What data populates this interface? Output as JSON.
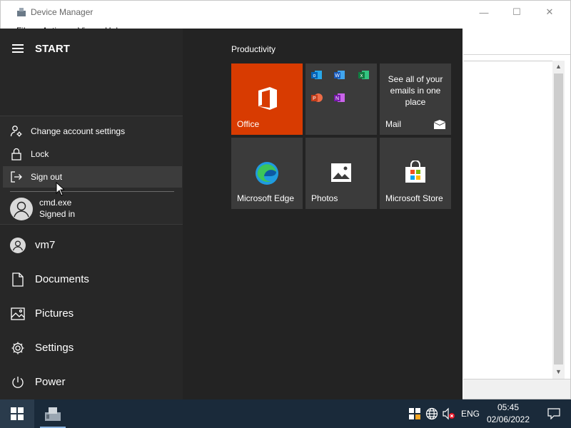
{
  "window": {
    "title": "Device Manager",
    "menu": [
      "File",
      "Action",
      "View",
      "Help"
    ],
    "controls": {
      "minimize": "—",
      "maximize": "☐",
      "close": "✕"
    }
  },
  "start": {
    "label": "START",
    "account_menu": [
      {
        "label": "Change account settings",
        "icon": "person-settings-icon"
      },
      {
        "label": "Lock",
        "icon": "lock-icon"
      },
      {
        "label": "Sign out",
        "icon": "sign-out-icon"
      }
    ],
    "other_user": {
      "name": "cmd.exe",
      "status": "Signed in"
    },
    "nav": [
      {
        "label": "vm7",
        "icon": "user-avatar-icon"
      },
      {
        "label": "Documents",
        "icon": "document-icon"
      },
      {
        "label": "Pictures",
        "icon": "pictures-icon"
      },
      {
        "label": "Settings",
        "icon": "gear-icon"
      },
      {
        "label": "Power",
        "icon": "power-icon"
      }
    ],
    "group_title": "Productivity",
    "tiles": {
      "office": "Office",
      "mail_text": "See all of your emails in one place",
      "mail": "Mail",
      "edge": "Microsoft Edge",
      "photos": "Photos",
      "store": "Microsoft Store"
    }
  },
  "taskbar": {
    "lang": "ENG",
    "time": "05:45",
    "date": "02/06/2022"
  },
  "colors": {
    "start_bg": "#232323",
    "office_tile": "#d83b01",
    "tile": "#3b3b3b",
    "taskbar": "#1a2a3a"
  }
}
